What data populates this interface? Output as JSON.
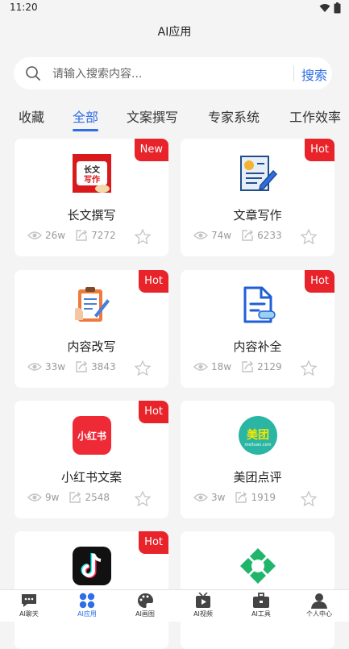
{
  "status": {
    "time": "11:20"
  },
  "header": {
    "title": "AI应用"
  },
  "search": {
    "placeholder": "请输入搜索内容...",
    "button": "搜索"
  },
  "tabs": [
    {
      "label": "收藏"
    },
    {
      "label": "全部"
    },
    {
      "label": "文案撰写"
    },
    {
      "label": "专家系统"
    },
    {
      "label": "工作效率"
    }
  ],
  "active_tab": "全部",
  "cards": [
    {
      "title": "长文撰写",
      "badge": "New",
      "views": "26w",
      "uses": "7272",
      "icon": "long-text-icon"
    },
    {
      "title": "文章写作",
      "badge": "Hot",
      "views": "74w",
      "uses": "6233",
      "icon": "article-writing-icon"
    },
    {
      "title": "内容改写",
      "badge": "Hot",
      "views": "33w",
      "uses": "3843",
      "icon": "clipboard-edit-icon"
    },
    {
      "title": "内容补全",
      "badge": "Hot",
      "views": "18w",
      "uses": "2129",
      "icon": "document-complete-icon"
    },
    {
      "title": "小红书文案",
      "badge": "Hot",
      "views": "9w",
      "uses": "2548",
      "icon": "xiaohongshu-icon"
    },
    {
      "title": "美团点评",
      "badge": "",
      "views": "3w",
      "uses": "1919",
      "icon": "meituan-icon"
    },
    {
      "title": "",
      "badge": "Hot",
      "views": "",
      "uses": "",
      "icon": "douyin-icon"
    },
    {
      "title": "",
      "badge": "",
      "views": "",
      "uses": "",
      "icon": "green-logo-icon"
    }
  ],
  "card_icon_text": {
    "long_text_line1": "长文",
    "long_text_line2": "写作",
    "xiaohongshu": "小红书",
    "meituan": "美团",
    "meituan_sub": "meituan.com"
  },
  "bottom_nav": [
    {
      "label": "AI聊天",
      "icon": "chat-icon"
    },
    {
      "label": "AI应用",
      "icon": "apps-icon"
    },
    {
      "label": "AI画图",
      "icon": "palette-icon"
    },
    {
      "label": "AI视频",
      "icon": "video-icon"
    },
    {
      "label": "AI工具",
      "icon": "toolbox-icon"
    },
    {
      "label": "个人中心",
      "icon": "user-icon"
    }
  ],
  "colors": {
    "accent": "#2f6ee6",
    "badge": "#e8232a",
    "background": "#f4f4f5"
  }
}
